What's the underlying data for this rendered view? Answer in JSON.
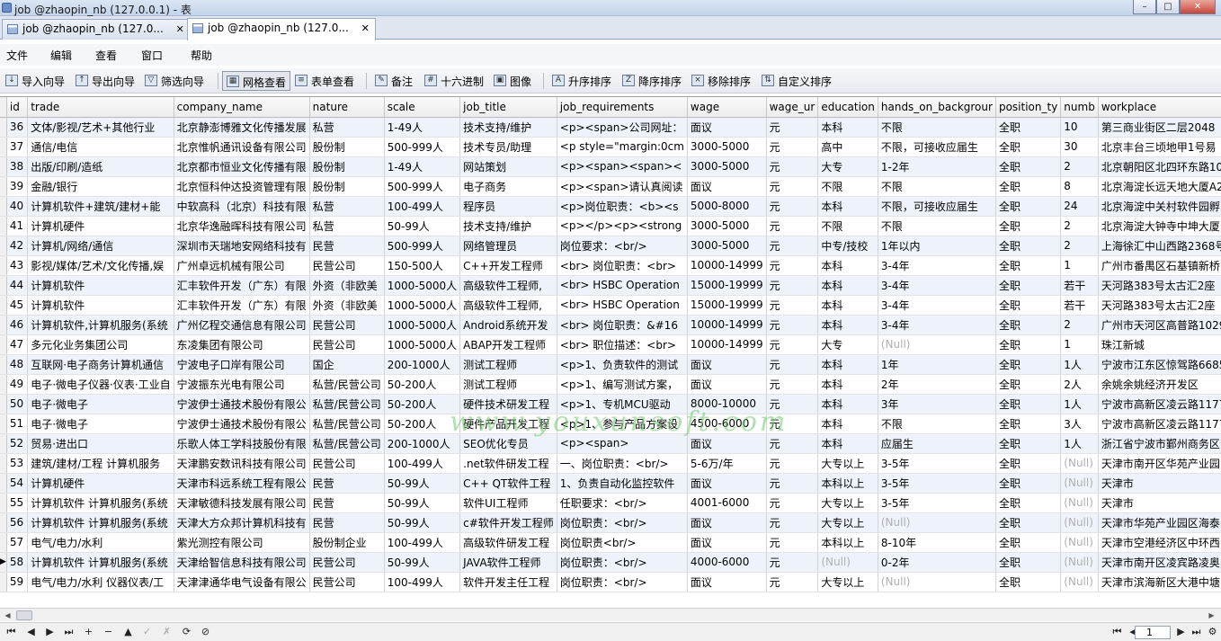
{
  "window": {
    "title": "job @zhaopin_nb (127.0.0.1) - 表",
    "controls": [
      "–",
      "□",
      "✕"
    ]
  },
  "tabs": [
    {
      "label": "job @zhaopin_nb (127.0...",
      "close": "✕"
    },
    {
      "label": "job @zhaopin_nb (127.0...",
      "close": "✕"
    }
  ],
  "menu": [
    "文件",
    "编辑",
    "查看",
    "窗口",
    "帮助"
  ],
  "toolbar": {
    "import_wizard": "导入向导",
    "export_wizard": "导出向导",
    "filter_wizard": "筛选向导",
    "grid_view": "网格查看",
    "form_view": "表单查看",
    "memo": "备注",
    "hex": "十六进制",
    "image": "图像",
    "sort_asc": "升序排序",
    "sort_desc": "降序排序",
    "remove_sort": "移除排序",
    "custom_sort": "自定义排序"
  },
  "columns": [
    "id",
    "trade",
    "company_name",
    "nature",
    "scale",
    "job_title",
    "job_requirements",
    "wage",
    "wage_ur",
    "education",
    "hands_on_backgrour",
    "position_ty",
    "numb",
    "workplace"
  ],
  "rows": [
    [
      "36",
      "文体/影视/艺术+其他行业",
      "北京静澎博雅文化传播发展",
      "私营",
      "1-49人",
      "技术支持/维护",
      "<p><span>公司网址：",
      "面议",
      "元",
      "本科",
      "不限",
      "全职",
      "10",
      "第三商业街区二层2048"
    ],
    [
      "37",
      "通信/电信",
      "北京惟帆通讯设备有限公司",
      "股份制",
      "500-999人",
      "技术专员/助理",
      "<p style=\"margin:0cm",
      "3000-5000",
      "元",
      "高中",
      "不限，可接收应届生",
      "全职",
      "30",
      "北京丰台三顷地甲1号易"
    ],
    [
      "38",
      "出版/印刷/造纸",
      "北京都市恒业文化传播有限",
      "股份制",
      "1-49人",
      "网站策划",
      "<p><span><span><",
      "3000-5000",
      "元",
      "大专",
      "1-2年",
      "全职",
      "2",
      "北京朝阳区北四环东路10"
    ],
    [
      "39",
      "金融/银行",
      "北京恒科仲达投资管理有限",
      "股份制",
      "500-999人",
      "电子商务",
      "<p><span>请认真阅读",
      "面议",
      "元",
      "不限",
      "不限",
      "全职",
      "8",
      "北京海淀长远天地大厦A2"
    ],
    [
      "40",
      "计算机软件+建筑/建材+能",
      "中软高科（北京）科技有限",
      "私营",
      "100-499人",
      "程序员",
      "<p>岗位职责：<b><s",
      "5000-8000",
      "元",
      "本科",
      "不限，可接收应届生",
      "全职",
      "24",
      "北京海淀中关村软件园孵"
    ],
    [
      "41",
      "计算机硬件",
      "北京华逸融晖科技有限公司",
      "私营",
      "50-99人",
      "技术支持/维护",
      "<p></p><p><strong",
      "3000-5000",
      "元",
      "不限",
      "不限",
      "全职",
      "2",
      "北京海淀大钟寺中坤大厦"
    ],
    [
      "42",
      "计算机/网络/通信",
      "深圳市天瑞地安网络科技有",
      "民营",
      "500-999人",
      "网络管理员",
      "岗位要求：<br/>",
      "3000-5000",
      "元",
      "中专/技校",
      "1年以内",
      "全职",
      "2",
      "上海徐汇中山西路2368号"
    ],
    [
      "43",
      "影视/媒体/艺术/文化传播,娱",
      "广州卓远机械有限公司",
      "民营公司",
      "150-500人",
      "C++开发工程师",
      "<br> 岗位职责：<br>",
      "10000-14999",
      "元",
      "本科",
      "3-4年",
      "全职",
      "1",
      "广州市番禺区石基镇新桥"
    ],
    [
      "44",
      "计算机软件",
      "汇丰软件开发（广东）有限",
      "外资（非欧美",
      "1000-5000人",
      "高级软件工程师,",
      "<br> HSBC Operation",
      "15000-19999",
      "元",
      "本科",
      "3-4年",
      "全职",
      "若干",
      "天河路383号太古汇2座（"
    ],
    [
      "45",
      "计算机软件",
      "汇丰软件开发（广东）有限",
      "外资（非欧美",
      "1000-5000人",
      "高级软件工程师,",
      "<br> HSBC Operation",
      "15000-19999",
      "元",
      "本科",
      "3-4年",
      "全职",
      "若干",
      "天河路383号太古汇2座（"
    ],
    [
      "46",
      "计算机软件,计算机服务(系统",
      "广州亿程交通信息有限公司",
      "民营公司",
      "1000-5000人",
      "Android系统开发",
      "<br> 岗位职责：&#16",
      "10000-14999",
      "元",
      "本科",
      "3-4年",
      "全职",
      "2",
      "广州市天河区高普路1029"
    ],
    [
      "47",
      "多元化业务集团公司",
      "东凌集团有限公司",
      "民营公司",
      "1000-5000人",
      "ABAP开发工程师",
      "<br> 职位描述：<br>",
      "10000-14999",
      "元",
      "大专",
      "(Null)",
      "全职",
      "1",
      "珠江新城"
    ],
    [
      "48",
      "互联网·电子商务计算机通信",
      "宁波电子口岸有限公司",
      "国企",
      "200-1000人",
      "测试工程师",
      "<p>1、负责软件的测试",
      "面议",
      "元",
      "本科",
      "1年",
      "全职",
      "1人",
      "宁波市江东区惊驾路6685"
    ],
    [
      "49",
      "电子·微电子仪器·仪表·工业自",
      "宁波振东光电有限公司",
      "私营/民营公司",
      "50-200人",
      "测试工程师",
      "<p>1、编写测试方案，",
      "面议",
      "元",
      "本科",
      "2年",
      "全职",
      "2人",
      "余姚余姚经济开发区"
    ],
    [
      "50",
      "电子·微电子",
      "宁波伊士通技术股份有限公",
      "私营/民营公司",
      "50-200人",
      "硬件技术研发工程",
      "<p>1、专机MCU驱动",
      "8000-10000",
      "元",
      "本科",
      "3年",
      "全职",
      "1人",
      "宁波市高新区凌云路1177"
    ],
    [
      "51",
      "电子·微电子",
      "宁波伊士通技术股份有限公",
      "私营/民营公司",
      "50-200人",
      "硬件产品开发工程",
      "<p>1、参与产品方案设",
      "4500-6000",
      "元",
      "本科",
      "不限",
      "全职",
      "3人",
      "宁波市高新区凌云路1177"
    ],
    [
      "52",
      "贸易·进出口",
      "乐歌人体工学科技股份有限",
      "私营/民营公司",
      "200-1000人",
      "SEO优化专员",
      "<p><span>",
      "面议",
      "元",
      "本科",
      "应届生",
      "全职",
      "1人",
      "浙江省宁波市鄞州商务区"
    ],
    [
      "53",
      "建筑/建材/工程 计算机服务",
      "天津鹏安数讯科技有限公司",
      "民营公司",
      "100-499人",
      ".net软件研发工程",
      "一、岗位职责：<br/>",
      "5-6万/年",
      "元",
      "大专以上",
      "3-5年",
      "全职",
      "(Null)",
      "天津市南开区华苑产业园"
    ],
    [
      "54",
      "计算机硬件",
      "天津市科远系统工程有限公",
      "民营",
      "50-99人",
      "C++ QT软件工程",
      "1、负责自动化监控软件",
      "面议",
      "元",
      "本科以上",
      "3-5年",
      "全职",
      "(Null)",
      "天津市"
    ],
    [
      "55",
      "计算机软件 计算机服务(系统",
      "天津敏德科技发展有限公司",
      "民营",
      "50-99人",
      "软件UI工程师",
      "任职要求：<br/>",
      "4001-6000",
      "元",
      "大专以上",
      "3-5年",
      "全职",
      "(Null)",
      "天津市"
    ],
    [
      "56",
      "计算机软件 计算机服务(系统",
      "天津大方众邦计算机科技有",
      "民营",
      "50-99人",
      "c#软件开发工程师",
      "岗位职责：<br/>",
      "面议",
      "元",
      "大专以上",
      "(Null)",
      "全职",
      "(Null)",
      "天津市华苑产业园区海泰"
    ],
    [
      "57",
      "电气/电力/水利",
      "紫光测控有限公司",
      "股份制企业",
      "100-499人",
      "高级软件研发工程",
      "岗位职责<br/>",
      "面议",
      "元",
      "本科以上",
      "8-10年",
      "全职",
      "(Null)",
      "天津市空港经济区中环西"
    ],
    [
      "58",
      "计算机软件 计算机服务(系统",
      "天津给智信息科技有限公司",
      "民营公司",
      "50-99人",
      "JAVA软件工程师",
      "岗位职责：<br/>",
      "4000-6000",
      "元",
      "(Null)",
      "0-2年",
      "全职",
      "(Null)",
      "天津市南开区凌宾路凌奥"
    ],
    [
      "59",
      "电气/电力/水利 仪器仪表/工",
      "天津津通华电气设备有限公",
      "民营公司",
      "100-499人",
      "软件开发主任工程",
      "岗位职责：<br/>",
      "面议",
      "元",
      "大专以上",
      "(Null)",
      "全职",
      "(Null)",
      "天津市滨海新区大港中塘"
    ]
  ],
  "selected_row_id": "58",
  "watermark": "www.youxunsoft.com",
  "nav": {
    "left": [
      "⏮",
      "◀",
      "▶",
      "⏭",
      "+",
      "−",
      "▲",
      "✓",
      "✗",
      "⟳",
      "⊘"
    ],
    "page": "1"
  }
}
